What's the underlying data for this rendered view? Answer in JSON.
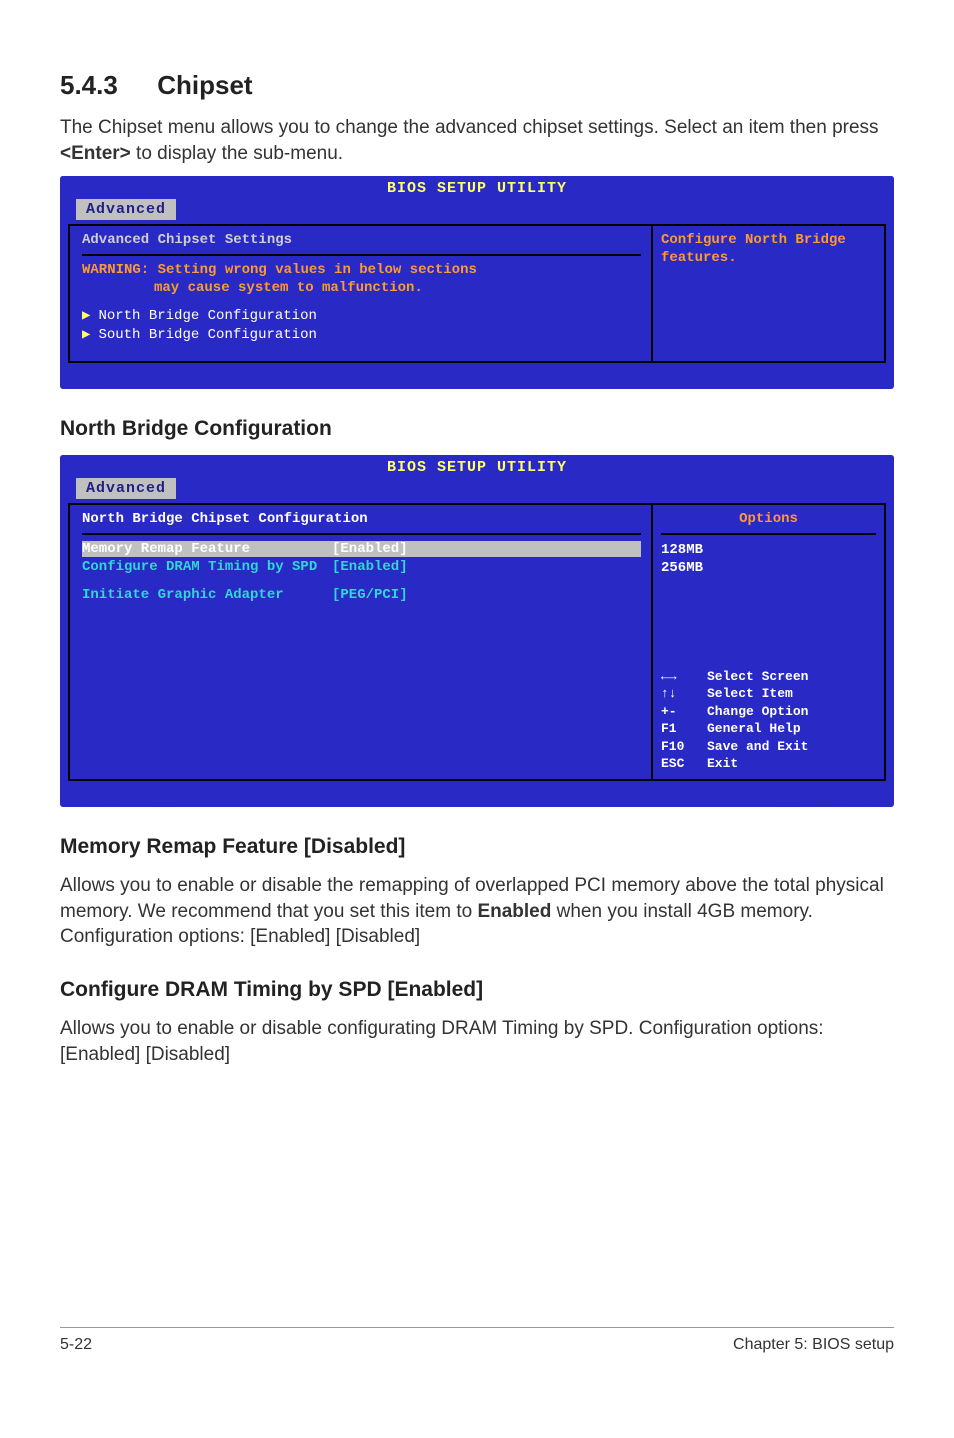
{
  "section": {
    "number": "5.4.3",
    "title": "Chipset",
    "intro_pre": "The Chipset menu allows you to change the advanced chipset settings. Select an item then press ",
    "intro_bold": "<Enter>",
    "intro_post": " to display the sub-menu."
  },
  "bios1": {
    "title": "BIOS SETUP UTILITY",
    "tab": "Advanced",
    "heading": "Advanced Chipset Settings",
    "warn_label": "WARNING:",
    "warn_line1": " Setting wrong values in below sections",
    "warn_line2": "may cause system to  malfunction.",
    "item1": "North Bridge Configuration",
    "item2": "South Bridge Configuration",
    "right_line1": "Configure North Bridge",
    "right_line2": "features."
  },
  "northbridge_heading": "North Bridge Configuration",
  "bios2": {
    "title": "BIOS SETUP UTILITY",
    "tab": "Advanced",
    "heading": "North Bridge Chipset Configuration",
    "rows": {
      "r1_label": "Memory Remap Feature",
      "r1_value": "[Enabled]",
      "r2_label": "Configure DRAM Timing by SPD",
      "r2_value": "[Enabled]",
      "r3_label": "Initiate Graphic Adapter",
      "r3_value": "[PEG/PCI]"
    },
    "options_label": "Options",
    "options": {
      "o1": "128MB",
      "o2": "256MB"
    },
    "help": {
      "k1": "←→",
      "v1": "Select Screen",
      "k2": "↑↓",
      "v2": "Select Item",
      "k3": "+-",
      "v3": "Change Option",
      "k4": "F1",
      "v4": "General Help",
      "k5": "F10",
      "v5": "Save and Exit",
      "k6": "ESC",
      "v6": "Exit"
    }
  },
  "memremap": {
    "heading": "Memory Remap Feature [Disabled]",
    "body_pre": "Allows you to enable or disable the  remapping of overlapped PCI memory above the total physical memory. We recommend that you set this item to ",
    "body_bold": "Enabled",
    "body_post": " when you install 4GB memory. Configuration options: [Enabled] [Disabled]"
  },
  "dram": {
    "heading": "Configure DRAM Timing by SPD [Enabled]",
    "body": "Allows you to enable or disable configurating DRAM Timing by SPD. Configuration options: [Enabled] [Disabled]"
  },
  "footer": {
    "left": "5-22",
    "right": "Chapter 5: BIOS setup"
  }
}
